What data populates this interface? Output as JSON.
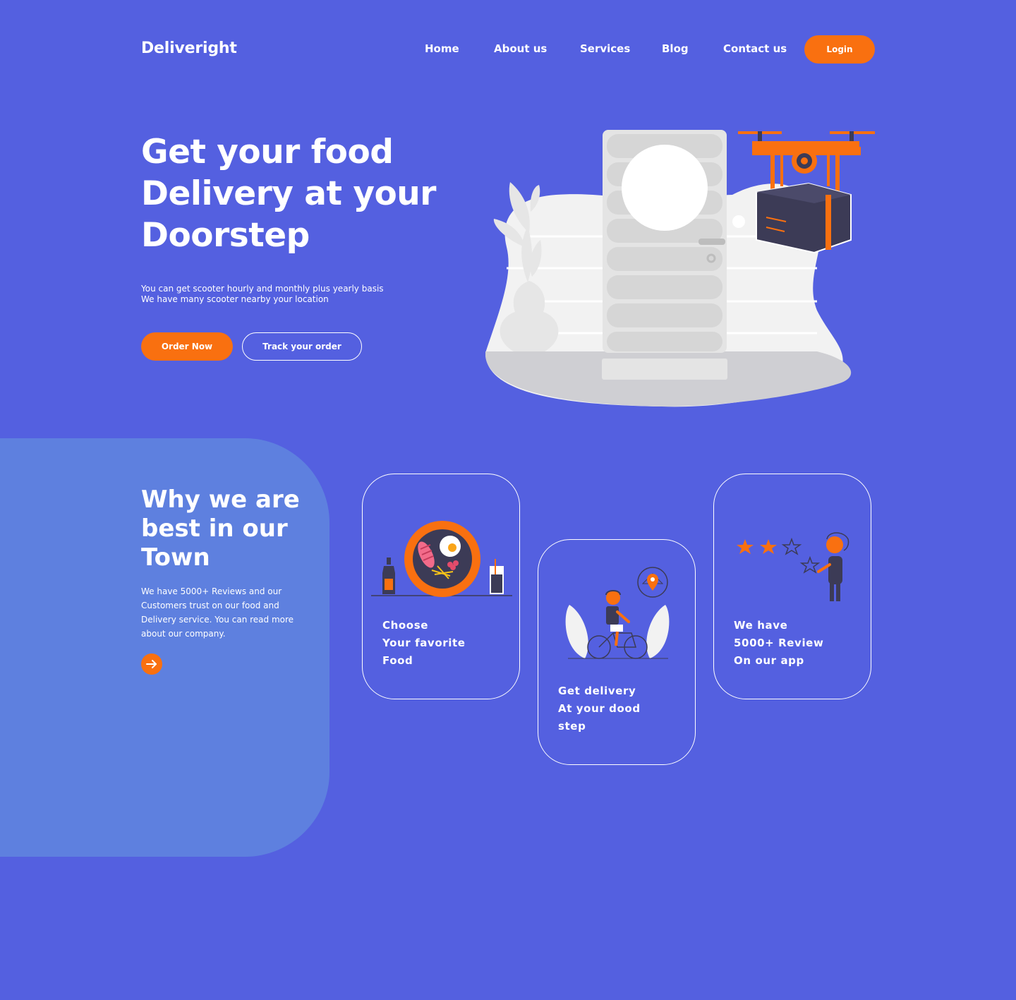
{
  "header": {
    "logo": "Deliveright",
    "nav": [
      "Home",
      "About us",
      "Services",
      "Blog",
      "Contact us"
    ],
    "login_label": "Login"
  },
  "hero": {
    "title_lines": [
      "Get your food",
      "Delivery at your",
      "Doorstep"
    ],
    "subtitle_lines": [
      "You can get scooter hourly and monthly plus yearly basis",
      "We have many scooter nearby your location"
    ],
    "order_label": "Order Now",
    "track_label": "Track your order"
  },
  "why": {
    "title_lines": [
      "Why we are",
      "best in our",
      "Town"
    ],
    "text_lines": [
      "We have 5000+ Reviews and our",
      "Customers trust on our food and",
      "Delivery service. You can read more",
      "about our company."
    ],
    "arrow_icon": "arrow-right-icon"
  },
  "cards": [
    {
      "lines": [
        "Choose",
        "Your favorite",
        "Food"
      ],
      "icon": "food-plate-illustration"
    },
    {
      "lines": [
        "Get delivery",
        "At your dood",
        "step"
      ],
      "icon": "cyclist-illustration"
    },
    {
      "lines": [
        "We have",
        "5000+ Review",
        "On our app"
      ],
      "icon": "review-stars-illustration"
    }
  ],
  "colors": {
    "background": "#5460e0",
    "panel": "#5e80df",
    "accent": "#f97010",
    "dark": "#3c3b56"
  }
}
